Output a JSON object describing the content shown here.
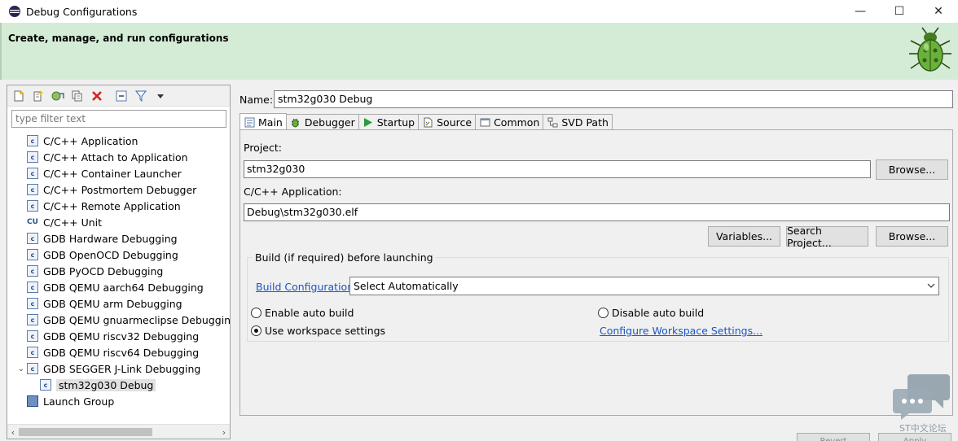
{
  "window": {
    "title": "Debug Configurations",
    "minimize": "—",
    "maximize": "☐",
    "close": "✕"
  },
  "banner": {
    "heading": "Create, manage, and run configurations"
  },
  "left": {
    "filter_placeholder": "type filter text",
    "tree": [
      {
        "label": "C/C++ Application",
        "icon": "c-config-icon"
      },
      {
        "label": "C/C++ Attach to Application",
        "icon": "c-config-icon"
      },
      {
        "label": "C/C++ Container Launcher",
        "icon": "c-config-icon"
      },
      {
        "label": "C/C++ Postmortem Debugger",
        "icon": "c-config-icon"
      },
      {
        "label": "C/C++ Remote Application",
        "icon": "c-config-icon"
      },
      {
        "label": "C/C++ Unit",
        "icon": "cu-unit-icon"
      },
      {
        "label": "GDB Hardware Debugging",
        "icon": "c-config-icon"
      },
      {
        "label": "GDB OpenOCD Debugging",
        "icon": "c-config-icon"
      },
      {
        "label": "GDB PyOCD Debugging",
        "icon": "c-config-icon"
      },
      {
        "label": "GDB QEMU aarch64 Debugging",
        "icon": "c-config-icon"
      },
      {
        "label": "GDB QEMU arm Debugging",
        "icon": "c-config-icon"
      },
      {
        "label": "GDB QEMU gnuarmeclipse Debugging",
        "icon": "c-config-icon"
      },
      {
        "label": "GDB QEMU riscv32 Debugging",
        "icon": "c-config-icon"
      },
      {
        "label": "GDB QEMU riscv64 Debugging",
        "icon": "c-config-icon"
      },
      {
        "label": "GDB SEGGER J-Link Debugging",
        "icon": "c-config-icon"
      },
      {
        "label": "stm32g030 Debug",
        "icon": "c-config-icon"
      },
      {
        "label": "Launch Group",
        "icon": "launch-group-icon"
      }
    ]
  },
  "right": {
    "name_label": "Name:",
    "name_value": "stm32g030 Debug",
    "tabs": [
      "Main",
      "Debugger",
      "Startup",
      "Source",
      "Common",
      "SVD Path"
    ],
    "project_label": "Project:",
    "project_value": "stm32g030",
    "browse_label": "Browse...",
    "app_label": "C/C++ Application:",
    "app_value": "Debug\\stm32g030.elf",
    "variables_label": "Variables...",
    "search_project_label": "Search Project...",
    "browse2_label": "Browse...",
    "build_group_title": "Build (if required) before launching",
    "build_config_link": "Build Configuration:",
    "build_config_value": "Select Automatically",
    "enable_auto_build": "Enable auto build",
    "disable_auto_build": "Disable auto build",
    "use_workspace": "Use workspace settings",
    "configure_workspace": "Configure Workspace Settings...",
    "bottom_btn_1": "Revert",
    "bottom_btn_2": "Apply"
  },
  "watermark": {
    "text": "ST中文论坛"
  },
  "colors": {
    "banner_bg": "#d4ecd6",
    "link": "#1a56c4",
    "bug_green": "#6ab13c"
  }
}
